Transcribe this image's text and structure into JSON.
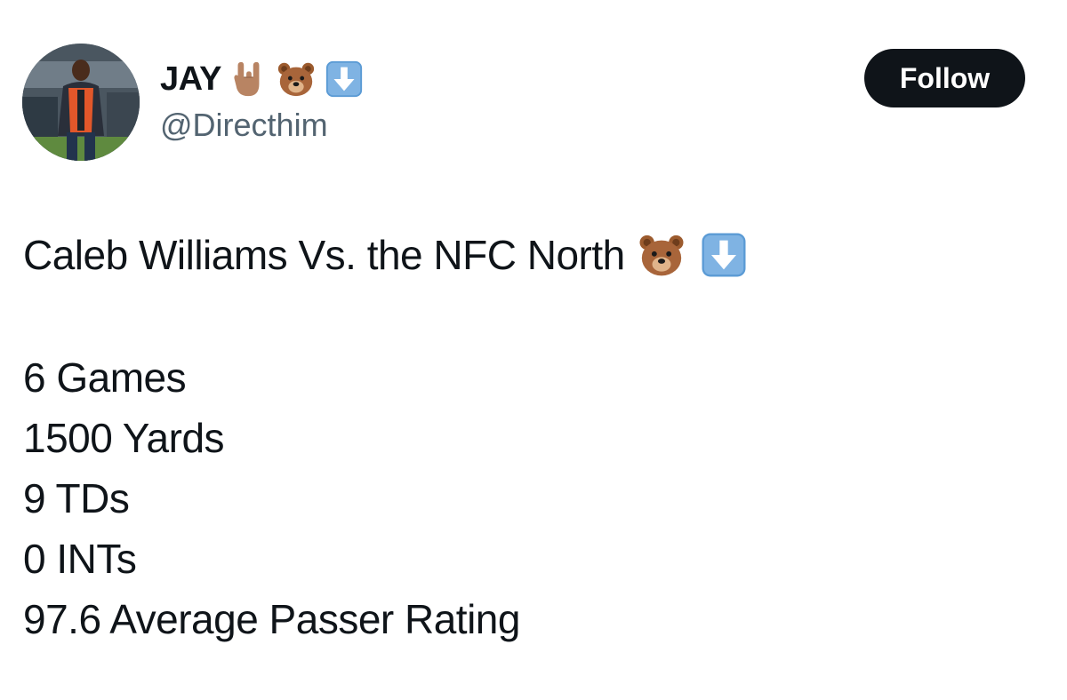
{
  "author": {
    "display_name": "JAY",
    "display_name_icons": [
      "rock-on-hand-icon",
      "bear-face-icon",
      "down-arrow-icon"
    ],
    "handle": "@Directhim",
    "avatar": "profile-photo"
  },
  "actions": {
    "follow_label": "Follow"
  },
  "post": {
    "headline": "Caleb Williams Vs. the NFC North",
    "headline_icons": [
      "bear-face-icon",
      "down-arrow-icon"
    ],
    "stats": [
      "6 Games",
      "1500 Yards",
      "9 TDs",
      "0 INTs",
      "97.6 Average Passer Rating"
    ]
  },
  "colors": {
    "text": "#0f1419",
    "secondary_text": "#536471",
    "follow_button_bg": "#0f1419",
    "follow_button_text": "#ffffff",
    "arrow_emoji_blue": "#5b9bd5",
    "bear_brown": "#9c5b2e"
  }
}
